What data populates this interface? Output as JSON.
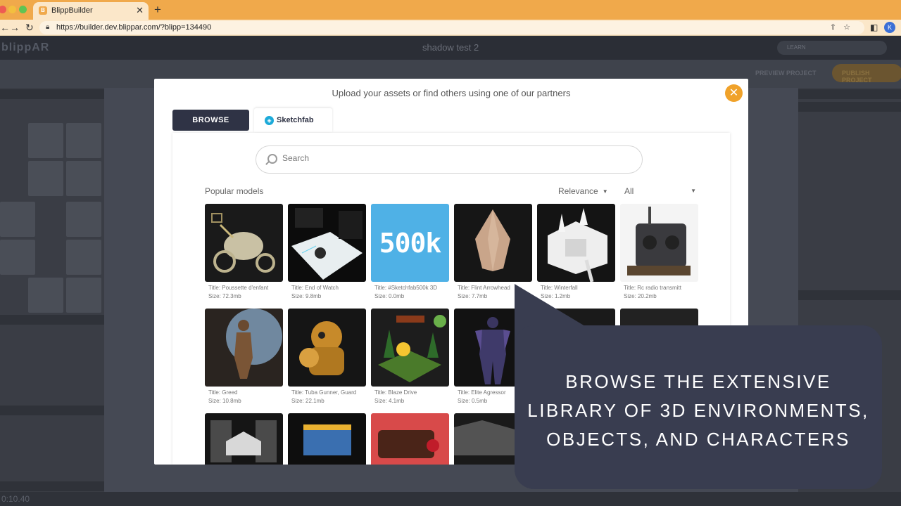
{
  "browser": {
    "tab_title": "BlippBuilder",
    "tab_favicon": "B",
    "url": "https://builder.dev.blippar.com/?blipp=134490",
    "avatar_initial": "K"
  },
  "app": {
    "logo": "blippAR",
    "project_name": "shadow test 2",
    "learn_label": "LEARN",
    "preview_label": "PREVIEW PROJECT",
    "publish_label": "PUBLISH PROJECT",
    "timecode": "0:10.40"
  },
  "modal": {
    "title": "Upload your assets or find others using one of our partners",
    "tabs": {
      "browse": "BROWSE",
      "sketchfab": "Sketchfab"
    },
    "search_placeholder": "Search",
    "section_label": "Popular models",
    "sort_value": "Relevance",
    "filter_value": "All",
    "models": [
      {
        "title": "Title: Poussette d'enfant",
        "size": "Size: 72.3mb"
      },
      {
        "title": "Title: End of Watch",
        "size": "Size: 9.8mb"
      },
      {
        "title": "Title: #Sketchfab500k 3D",
        "size": "Size: 0.0mb",
        "badge": "500k"
      },
      {
        "title": "Title: Flint Arrowhead",
        "size": "Size: 7.7mb"
      },
      {
        "title": "Title: Winterfall",
        "size": "Size: 1.2mb"
      },
      {
        "title": "Title: Rc radio transmitt",
        "size": "Size: 20.2mb"
      },
      {
        "title": "Title: Greed",
        "size": "Size: 10.8mb"
      },
      {
        "title": "Title: Tuba Gunner, Guard",
        "size": "Size: 22.1mb"
      },
      {
        "title": "Title: Blaze Drive",
        "size": "Size: 4.1mb"
      },
      {
        "title": "Title: Elite Agressor",
        "size": "Size: 0.5mb"
      }
    ]
  },
  "callout": {
    "lines": [
      "BROWSE THE EXTENSIVE",
      "LIBRARY OF 3D ENVIRONMENTS,",
      "OBJECTS, AND CHARACTERS"
    ]
  },
  "colors": {
    "tabbar": "#f0a94b",
    "browse_tab": "#2f3345",
    "close_button": "#f0a22a",
    "callout_bg": "#393d50",
    "sketchfab_blue": "#1caad9"
  }
}
